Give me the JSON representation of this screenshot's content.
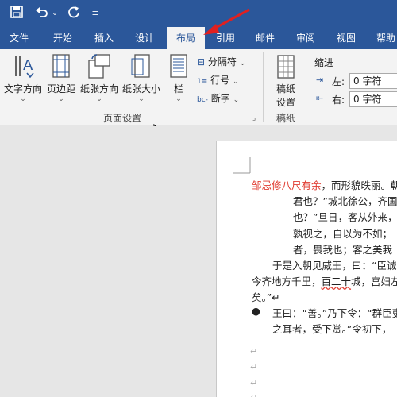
{
  "quick_access": {
    "save_icon": "save-icon",
    "undo_icon": "undo-icon",
    "redo_icon": "redo-icon",
    "customize_icon": "customize-icon"
  },
  "tabs": [
    {
      "label": "文件"
    },
    {
      "label": "开始"
    },
    {
      "label": "插入"
    },
    {
      "label": "设计"
    },
    {
      "label": "布局",
      "active": true
    },
    {
      "label": "引用"
    },
    {
      "label": "邮件"
    },
    {
      "label": "审阅"
    },
    {
      "label": "视图"
    },
    {
      "label": "帮助"
    }
  ],
  "ribbon": {
    "text_direction": "文字方向",
    "margins": "页边距",
    "orientation": "纸张方向",
    "size": "纸张大小",
    "columns": "栏",
    "breaks": "分隔符",
    "line_numbers": "行号",
    "hyphenation": "断字",
    "page_setup_group": "页面设置",
    "manuscript": "稿纸",
    "manuscript_line2": "设置",
    "manuscript_group": "稿纸",
    "indent_title": "缩进",
    "indent_left_label": "左:",
    "indent_left_value": "0 字符",
    "indent_right_label": "右:",
    "indent_right_value": "0 字符"
  },
  "document": {
    "line1_red": "邹忌修八尺有余",
    "line1_rest": "，而形貌昳丽。朝",
    "line2": "君也？”城北徐公，齐国",
    "line3": "也？”旦日，客从外来，",
    "line4": "孰视之，自以为不如；",
    "line5": "者，畏我也；客之美我",
    "line6": "于是入朝见威王，曰：“臣诚",
    "line7_pre": "今齐地方千里，",
    "line7_ul": "百二十",
    "line7_post": "城，宫妇左",
    "line8": "矣。”↵",
    "line9_bullet": "●",
    "line9": "王曰：“善。”乃下令：“群臣吏",
    "line10": "之耳者，受下赏。”令初下，",
    "para_mark": "↵"
  },
  "colors": {
    "accent": "#2b579a",
    "red_text": "#e03c31",
    "arrow": "#e02020"
  }
}
